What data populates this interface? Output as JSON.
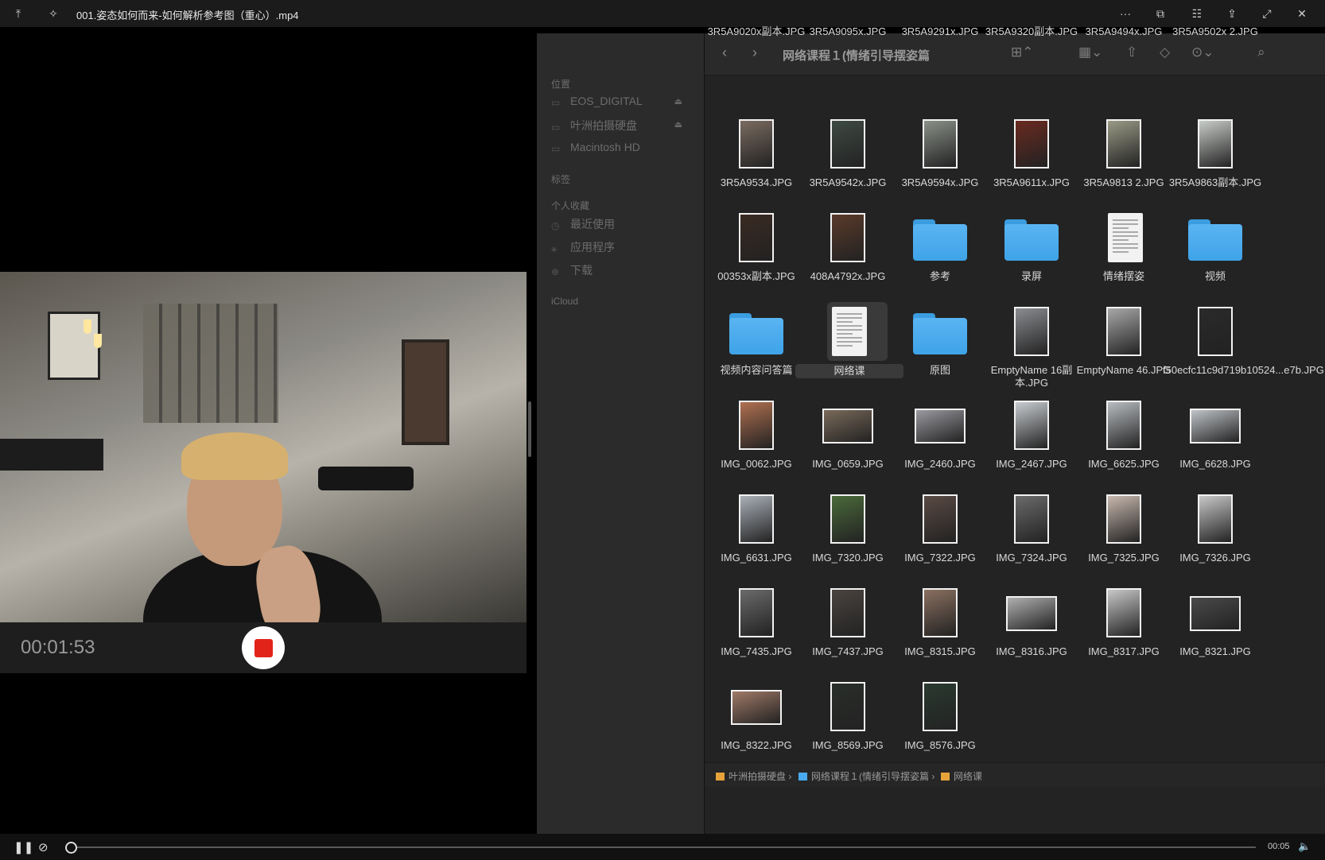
{
  "titlebar": {
    "title": "001.姿态如何而来-如何解析参考图（重心）.mp4",
    "icons": [
      "pin-top-icon",
      "pin-icon",
      "more-icon",
      "screenshot-icon",
      "settings-icon",
      "share-icon",
      "fullscreen-icon",
      "close-icon"
    ]
  },
  "recorder": {
    "timer": "00:01:53"
  },
  "finder": {
    "title": "网络课程１(情绪引导摆姿篇",
    "sidebar": {
      "location_header": "位置",
      "locations": [
        "EOS_DIGITAL",
        "叶洲拍摄硬盘",
        "Macintosh HD"
      ],
      "tags_header": "标签",
      "favorites_header": "个人收藏",
      "favorites": [
        "最近使用",
        "应用程序",
        "下载"
      ],
      "icloud_header": "iCloud"
    },
    "items": [
      {
        "name": "3R5A9020x副本.JPG",
        "kind": "partial"
      },
      {
        "name": "3R5A9095x.JPG",
        "kind": "partial"
      },
      {
        "name": "3R5A9291x.JPG",
        "kind": "partial"
      },
      {
        "name": "3R5A9320副本.JPG",
        "kind": "partial"
      },
      {
        "name": "3R5A9494x.JPG",
        "kind": "partial"
      },
      {
        "name": "3R5A9502x 2.JPG",
        "kind": "partial"
      },
      {
        "name": "3R5A9534.JPG",
        "kind": "photo",
        "color": "#7a6b60"
      },
      {
        "name": "3R5A9542x.JPG",
        "kind": "photo",
        "color": "#3f4a44"
      },
      {
        "name": "3R5A9594x.JPG",
        "kind": "photo",
        "color": "#8a9088"
      },
      {
        "name": "3R5A9611x.JPG",
        "kind": "photo",
        "color": "#6a2a20"
      },
      {
        "name": "3R5A9813 2.JPG",
        "kind": "photo",
        "color": "#9a9a86"
      },
      {
        "name": "3R5A9863副本.JPG",
        "kind": "photo",
        "color": "#c8ccc8"
      },
      {
        "name": "00353x副本.JPG",
        "kind": "photo",
        "color": "#3a2a22"
      },
      {
        "name": "408A4792x.JPG",
        "kind": "photo",
        "color": "#5a3a2a"
      },
      {
        "name": "参考",
        "kind": "folder"
      },
      {
        "name": "录屏",
        "kind": "folder"
      },
      {
        "name": "情绪摆姿",
        "kind": "doc"
      },
      {
        "name": "视频",
        "kind": "folder"
      },
      {
        "name": "视频内容问答篇",
        "kind": "folder"
      },
      {
        "name": "网络课",
        "kind": "doc",
        "selected": true
      },
      {
        "name": "原图",
        "kind": "folder"
      },
      {
        "name": "EmptyName 16副本.JPG",
        "kind": "photo",
        "color": "#8a8c90"
      },
      {
        "name": "EmptyName 46.JPG",
        "kind": "photo",
        "color": "#a8a8a8"
      },
      {
        "name": "f50ecfc11c9d719b10524...e7b.JPG",
        "kind": "photo",
        "color": "#2a2a2a"
      },
      {
        "name": "IMG_0062.JPG",
        "kind": "photo",
        "color": "#b07050"
      },
      {
        "name": "IMG_0659.JPG",
        "kind": "photo-land",
        "color": "#7a6a5a"
      },
      {
        "name": "IMG_2460.JPG",
        "kind": "photo-land",
        "color": "#9a9aa0"
      },
      {
        "name": "IMG_2467.JPG",
        "kind": "photo",
        "color": "#c8ccd0"
      },
      {
        "name": "IMG_6625.JPG",
        "kind": "photo",
        "color": "#b8bcc0"
      },
      {
        "name": "IMG_6628.JPG",
        "kind": "photo-land",
        "color": "#c0c4c8"
      },
      {
        "name": "IMG_6631.JPG",
        "kind": "photo",
        "color": "#aab0b8"
      },
      {
        "name": "IMG_7320.JPG",
        "kind": "photo",
        "color": "#4a6a3a"
      },
      {
        "name": "IMG_7322.JPG",
        "kind": "photo",
        "color": "#5a4a44"
      },
      {
        "name": "IMG_7324.JPG",
        "kind": "photo",
        "color": "#6a6a6a"
      },
      {
        "name": "IMG_7325.JPG",
        "kind": "photo",
        "color": "#c8b8ae"
      },
      {
        "name": "IMG_7326.JPG",
        "kind": "photo",
        "color": "#c8c8c8"
      },
      {
        "name": "IMG_7435.JPG",
        "kind": "photo",
        "color": "#6a6a6a"
      },
      {
        "name": "IMG_7437.JPG",
        "kind": "photo",
        "color": "#4a4440"
      },
      {
        "name": "IMG_8315.JPG",
        "kind": "photo",
        "color": "#8a7060"
      },
      {
        "name": "IMG_8316.JPG",
        "kind": "photo-land",
        "color": "#b0b0b0"
      },
      {
        "name": "IMG_8317.JPG",
        "kind": "photo",
        "color": "#c8c8c8"
      },
      {
        "name": "IMG_8321.JPG",
        "kind": "photo-land",
        "color": "#4a4a4a"
      },
      {
        "name": "IMG_8322.JPG",
        "kind": "photo-land",
        "color": "#a07a68"
      },
      {
        "name": "IMG_8569.JPG",
        "kind": "photo",
        "color": "#2a2e2a"
      },
      {
        "name": "IMG_8576.JPG",
        "kind": "photo",
        "color": "#2a3a30"
      }
    ],
    "path": [
      "叶洲拍摄硬盘",
      "网络课程１(情绪引导摆姿篇",
      "网络课"
    ]
  },
  "player": {
    "time": "00:05"
  },
  "colors": {
    "folder": "#4aaaf0",
    "record": "#e2231a"
  }
}
